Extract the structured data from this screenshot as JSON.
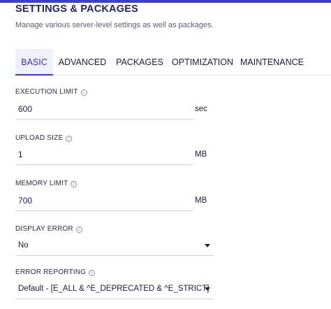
{
  "header": {
    "title": "SETTINGS & PACKAGES",
    "subtitle": "Manage various server-level settings as well as packages."
  },
  "tabs": [
    {
      "label": "BASIC",
      "active": true
    },
    {
      "label": "ADVANCED",
      "active": false
    },
    {
      "label": "PACKAGES",
      "active": false
    },
    {
      "label": "OPTIMIZATION",
      "active": false
    },
    {
      "label": "MAINTENANCE",
      "active": false
    }
  ],
  "fields": {
    "execution_limit": {
      "label": "EXECUTION LIMIT",
      "value": "600",
      "unit": "sec"
    },
    "upload_size": {
      "label": "UPLOAD SIZE",
      "value": "1",
      "unit": "MB"
    },
    "memory_limit": {
      "label": "MEMORY LIMIT",
      "value": "700",
      "unit": "MB"
    },
    "display_error": {
      "label": "DISPLAY ERROR",
      "value": "No"
    },
    "error_reporting": {
      "label": "ERROR REPORTING",
      "value": "Default - [E_ALL & ^E_DEPRECATED & ^E_STRICT]"
    }
  },
  "icons": {
    "info": "info-icon",
    "dropdown": "chevron-down-icon"
  },
  "colors": {
    "accent": "#3e3fc6",
    "active_tab_bg": "#eef0fb",
    "title": "#1f2460"
  }
}
